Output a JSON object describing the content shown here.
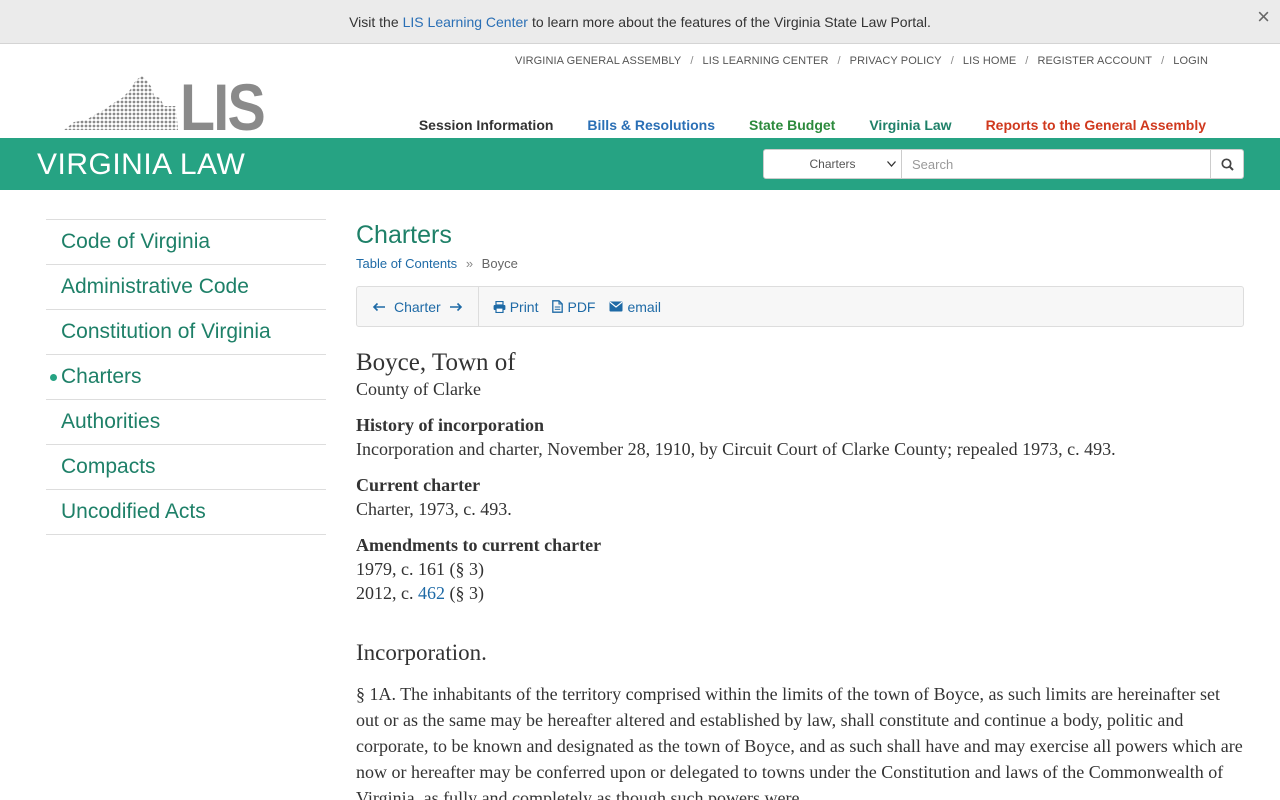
{
  "notice": {
    "prefix": "Visit the",
    "link": "LIS Learning Center",
    "suffix": "to learn more about the features of the Virginia State Law Portal.",
    "close": "×"
  },
  "utility_links": [
    "VIRGINIA GENERAL ASSEMBLY",
    "LIS LEARNING CENTER",
    "PRIVACY POLICY",
    "LIS HOME",
    "REGISTER ACCOUNT",
    "LOGIN"
  ],
  "logo": {
    "text": "LIS"
  },
  "main_nav": [
    {
      "label": "Session Information",
      "color": "#333333"
    },
    {
      "label": "Bills & Resolutions",
      "color": "#2a6fb5"
    },
    {
      "label": "State Budget",
      "color": "#2c8a3c"
    },
    {
      "label": "Virginia Law",
      "color": "#1e8068"
    },
    {
      "label": "Reports to the General Assembly",
      "color": "#d0391e"
    }
  ],
  "banner": {
    "title": "VIRGINIA LAW",
    "search_scope": "Charters",
    "search_placeholder": "Search",
    "color": "#26a383"
  },
  "sidebar": {
    "items": [
      {
        "label": "Code of Virginia",
        "active": false
      },
      {
        "label": "Administrative Code",
        "active": false
      },
      {
        "label": "Constitution of Virginia",
        "active": false
      },
      {
        "label": "Charters",
        "active": true
      },
      {
        "label": "Authorities",
        "active": false
      },
      {
        "label": "Compacts",
        "active": false
      },
      {
        "label": "Uncodified Acts",
        "active": false
      }
    ]
  },
  "content": {
    "page_title": "Charters",
    "breadcrumb": {
      "link": "Table of Contents",
      "separator": "»",
      "current": "Boyce"
    },
    "toolbar": {
      "nav_label": "Charter",
      "print": "Print",
      "pdf": "PDF",
      "email": "email"
    },
    "heading": "Boyce, Town of",
    "county": "County of Clarke",
    "history_heading": "History of incorporation",
    "history_text": "Incorporation and charter, November 28, 1910, by Circuit Court of Clarke County; repealed 1973, c. 493.",
    "current_heading": "Current charter",
    "current_text": "Charter, 1973, c. 493.",
    "amend_heading": "Amendments to current charter",
    "amend_1": "1979, c. 161 (§ 3)",
    "amend_2_prefix": "2012, c.",
    "amend_2_link": "462",
    "amend_2_suffix": "(§ 3)",
    "section_heading": "Incorporation.",
    "section_text": "§ 1A. The inhabitants of the territory comprised within the limits of the town of Boyce, as such limits are hereinafter set out or as the same may be hereafter altered and established by law, shall constitute and continue a body, politic and corporate, to be known and designated as the town of Boyce, and as such shall have and may exercise all powers which are now or hereafter may be conferred upon or delegated to towns under the Constitution and laws of the Commonwealth of Virginia, as fully and completely as though such powers were"
  }
}
